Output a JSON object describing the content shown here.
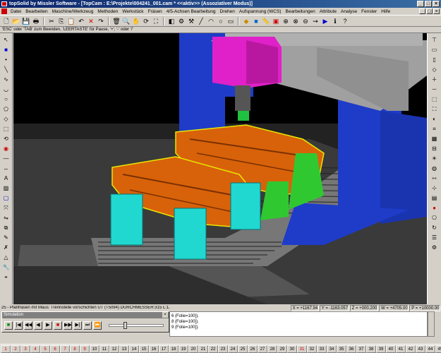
{
  "window": {
    "title": "topSolid by Missler Software - [TopCam : E:\\Projekte\\004241_001.cam *  <<aktiv>> (Assoziativer Modus)]",
    "controls": [
      "_",
      "□",
      "×"
    ]
  },
  "menu": {
    "items": [
      "Datei",
      "Bearbeiten",
      "Maschine/Werkzeug",
      "Methoden",
      "Werkstück",
      "Fräsen",
      "4/5-Achsen Bearbeitung",
      "Drehen",
      "Aufspannung (WCS)",
      "Bearbeitungen",
      "Attribute",
      "Analyse",
      "Fenster",
      "Hilfe"
    ],
    "doc_controls": [
      "_",
      "□",
      "×"
    ]
  },
  "toolbar": {
    "icons": [
      "new-file-icon",
      "open-icon",
      "save-icon",
      "print-icon",
      "cut-icon",
      "copy-icon",
      "paste-icon",
      "undo-icon",
      "cancel-icon",
      "redo-icon",
      "trash-icon",
      "zoom-icon",
      "pan-icon",
      "rotate-icon",
      "fit-icon",
      "layer-icon",
      "gear-icon",
      "tool-icon",
      "line-icon",
      "arc-icon",
      "circle-icon",
      "shape-icon",
      "surface-icon",
      "solid-icon",
      "measure-icon",
      "machine-icon",
      "mill-icon",
      "drill-icon",
      "lathe-icon",
      "path-icon",
      "sim-icon",
      "info-icon",
      "help-icon"
    ]
  },
  "prompt": {
    "text": "'ESC' oder 'TAB' zum Beenden, 'LEERTASTE' für Pause, '+', '-' oder '/'"
  },
  "status": {
    "message": "25 - Planfräsen mit Maus: Trennstelle vorschichten UT   (T5094)  DURCHMESSER:315  L:1.",
    "x": "X = +1167.94",
    "y": "Y = -1163.057",
    "z": "Z = +000.200",
    "w": "W = +4705.00",
    "p": "P = +10000.00"
  },
  "simulation": {
    "title": "Simulation",
    "buttons": [
      "■",
      "|◀",
      "◀◀",
      "◀",
      "▶",
      "■",
      "▶▶",
      "▶|",
      "⏭",
      "⏩"
    ]
  },
  "log": {
    "lines": [
      "6 (Folie=100]).",
      "8 (Folie=100]).",
      "9 (Folie=100])."
    ]
  },
  "tabs": {
    "labels": [
      "1",
      "2",
      "3",
      "4",
      "5",
      "6",
      "7",
      "8",
      "9",
      "10",
      "11",
      "12",
      "13",
      "14",
      "15",
      "16",
      "17",
      "18",
      "19",
      "20",
      "21",
      "22",
      "23",
      "24",
      "25",
      "26",
      "27",
      "28",
      "29",
      "30",
      "31",
      "32",
      "33",
      "34",
      "35",
      "36",
      "37",
      "38",
      "39",
      "40",
      "41",
      "42",
      "43",
      "44",
      "45",
      "46",
      "47",
      "48",
      "49"
    ],
    "active_color": "#cc0000"
  },
  "colors": {
    "machine_blue": "#1e3cc8",
    "spindle_magenta": "#e020c8",
    "part_orange": "#d8620a",
    "fixture_cyan": "#20d8d0",
    "fixture_green": "#30c830",
    "tool_green": "#20c040",
    "machine_gray": "#a0a0a0",
    "outline_yellow": "#e8e800"
  }
}
